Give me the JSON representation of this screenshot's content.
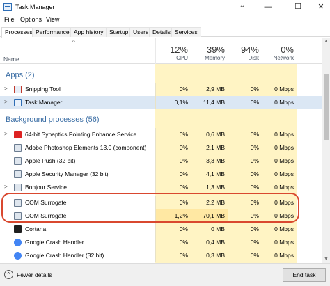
{
  "window": {
    "title": "Task Manager",
    "controls": {
      "minimize": "—",
      "maximize": "☐",
      "close": "✕"
    }
  },
  "menu": [
    "File",
    "Options",
    "View"
  ],
  "tabs": [
    "Processes",
    "Performance",
    "App history",
    "Startup",
    "Users",
    "Details",
    "Services"
  ],
  "columns": {
    "name": "Name",
    "cpu": {
      "pct": "12%",
      "label": "CPU"
    },
    "memory": {
      "pct": "39%",
      "label": "Memory"
    },
    "disk": {
      "pct": "94%",
      "label": "Disk"
    },
    "network": {
      "pct": "0%",
      "label": "Network"
    }
  },
  "groups": {
    "apps": "Apps (2)",
    "background": "Background processes (56)"
  },
  "rows": [
    {
      "name": "Snipping Tool",
      "cpu": "0%",
      "mem": "2,9 MB",
      "disk": "0%",
      "net": "0 Mbps"
    },
    {
      "name": "Task Manager",
      "cpu": "0,1%",
      "mem": "11,4 MB",
      "disk": "0%",
      "net": "0 Mbps"
    },
    {
      "name": "64-bit Synaptics Pointing Enhance Service",
      "cpu": "0%",
      "mem": "0,6 MB",
      "disk": "0%",
      "net": "0 Mbps"
    },
    {
      "name": "Adobe Photoshop Elements 13.0 (component)",
      "cpu": "0%",
      "mem": "2,1 MB",
      "disk": "0%",
      "net": "0 Mbps"
    },
    {
      "name": "Apple Push (32 bit)",
      "cpu": "0%",
      "mem": "3,3 MB",
      "disk": "0%",
      "net": "0 Mbps"
    },
    {
      "name": "Apple Security Manager (32 bit)",
      "cpu": "0%",
      "mem": "4,1 MB",
      "disk": "0%",
      "net": "0 Mbps"
    },
    {
      "name": "Bonjour Service",
      "cpu": "0%",
      "mem": "1,3 MB",
      "disk": "0%",
      "net": "0 Mbps"
    },
    {
      "name": "COM Surrogate",
      "cpu": "0%",
      "mem": "2,2 MB",
      "disk": "0%",
      "net": "0 Mbps"
    },
    {
      "name": "COM Surrogate",
      "cpu": "1,2%",
      "mem": "70,1 MB",
      "disk": "0%",
      "net": "0 Mbps"
    },
    {
      "name": "Cortana",
      "cpu": "0%",
      "mem": "0 MB",
      "disk": "0%",
      "net": "0 Mbps"
    },
    {
      "name": "Google Crash Handler",
      "cpu": "0%",
      "mem": "0,4 MB",
      "disk": "0%",
      "net": "0 Mbps"
    },
    {
      "name": "Google Crash Handler (32 bit)",
      "cpu": "0%",
      "mem": "0,3 MB",
      "disk": "0%",
      "net": "0 Mbps"
    }
  ],
  "footer": {
    "fewer_details": "Fewer details",
    "end_task": "End task"
  }
}
